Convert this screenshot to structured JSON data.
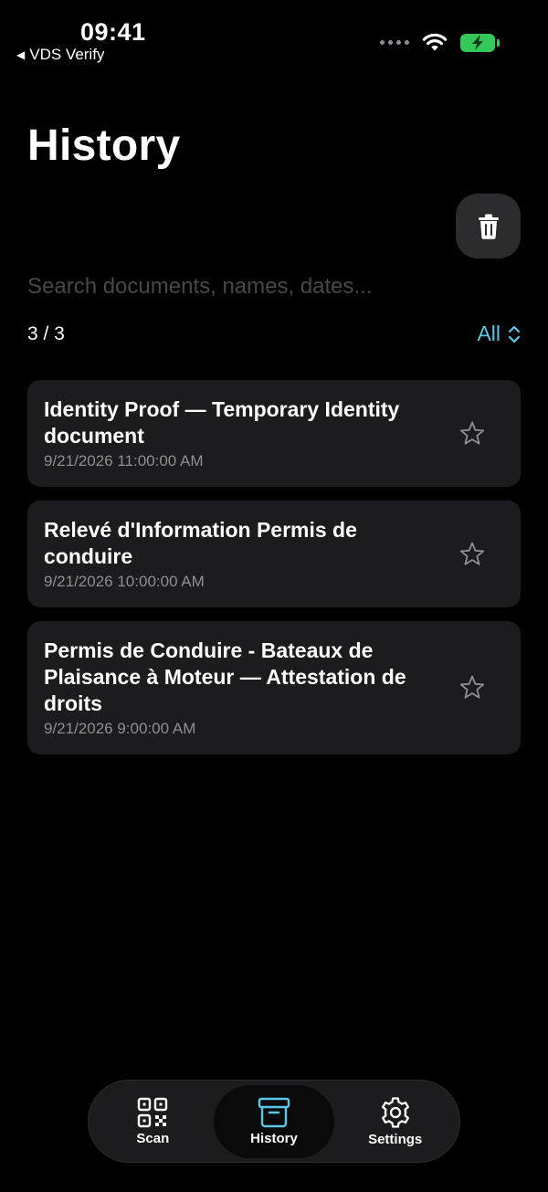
{
  "status": {
    "time": "09:41",
    "back_label": "VDS Verify"
  },
  "page": {
    "title": "History"
  },
  "search": {
    "placeholder": "Search documents, names, dates..."
  },
  "results": {
    "count": "3 / 3",
    "filter_label": "All"
  },
  "documents": [
    {
      "title": "Identity Proof — Temporary Identity document",
      "date": "9/21/2026 11:00:00 AM"
    },
    {
      "title": "Relevé d'Information Permis de conduire",
      "date": "9/21/2026 10:00:00 AM"
    },
    {
      "title": "Permis de Conduire - Bateaux de Plaisance à Moteur — Attestation de droits",
      "date": "9/21/2026 9:00:00 AM"
    }
  ],
  "tabs": [
    {
      "label": "Scan",
      "icon": "qr-code-icon"
    },
    {
      "label": "History",
      "icon": "archive-box-icon",
      "active": true
    },
    {
      "label": "Settings",
      "icon": "gear-icon"
    }
  ],
  "colors": {
    "accent": "#5ac8e6",
    "battery": "#34c759",
    "card_background": "#1c1c1e"
  }
}
